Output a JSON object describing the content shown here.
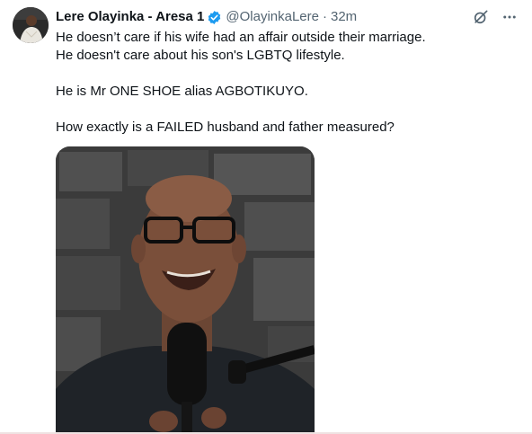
{
  "author": {
    "name": "Lere Olayinka - Aresa 1",
    "handle": "@OlayinkaLere",
    "separator": "·",
    "time": "32m",
    "verified_color": "#1d9bf0"
  },
  "tweet": {
    "lines": [
      "He doesn’t care if his wife had an affair outside their marriage.",
      "He doesn't care about his son's LGBTQ lifestyle.",
      "",
      "He is Mr ONE SHOE alias AGBOTIKUYO.",
      "",
      "How exactly is a FAILED husband and father measured?"
    ]
  },
  "icons": {
    "verified": "verified-badge-icon",
    "grok": "grok-icon",
    "more": "more-icon"
  },
  "colors": {
    "text": "#0f1419",
    "secondary": "#536471",
    "accent": "#1d9bf0"
  }
}
